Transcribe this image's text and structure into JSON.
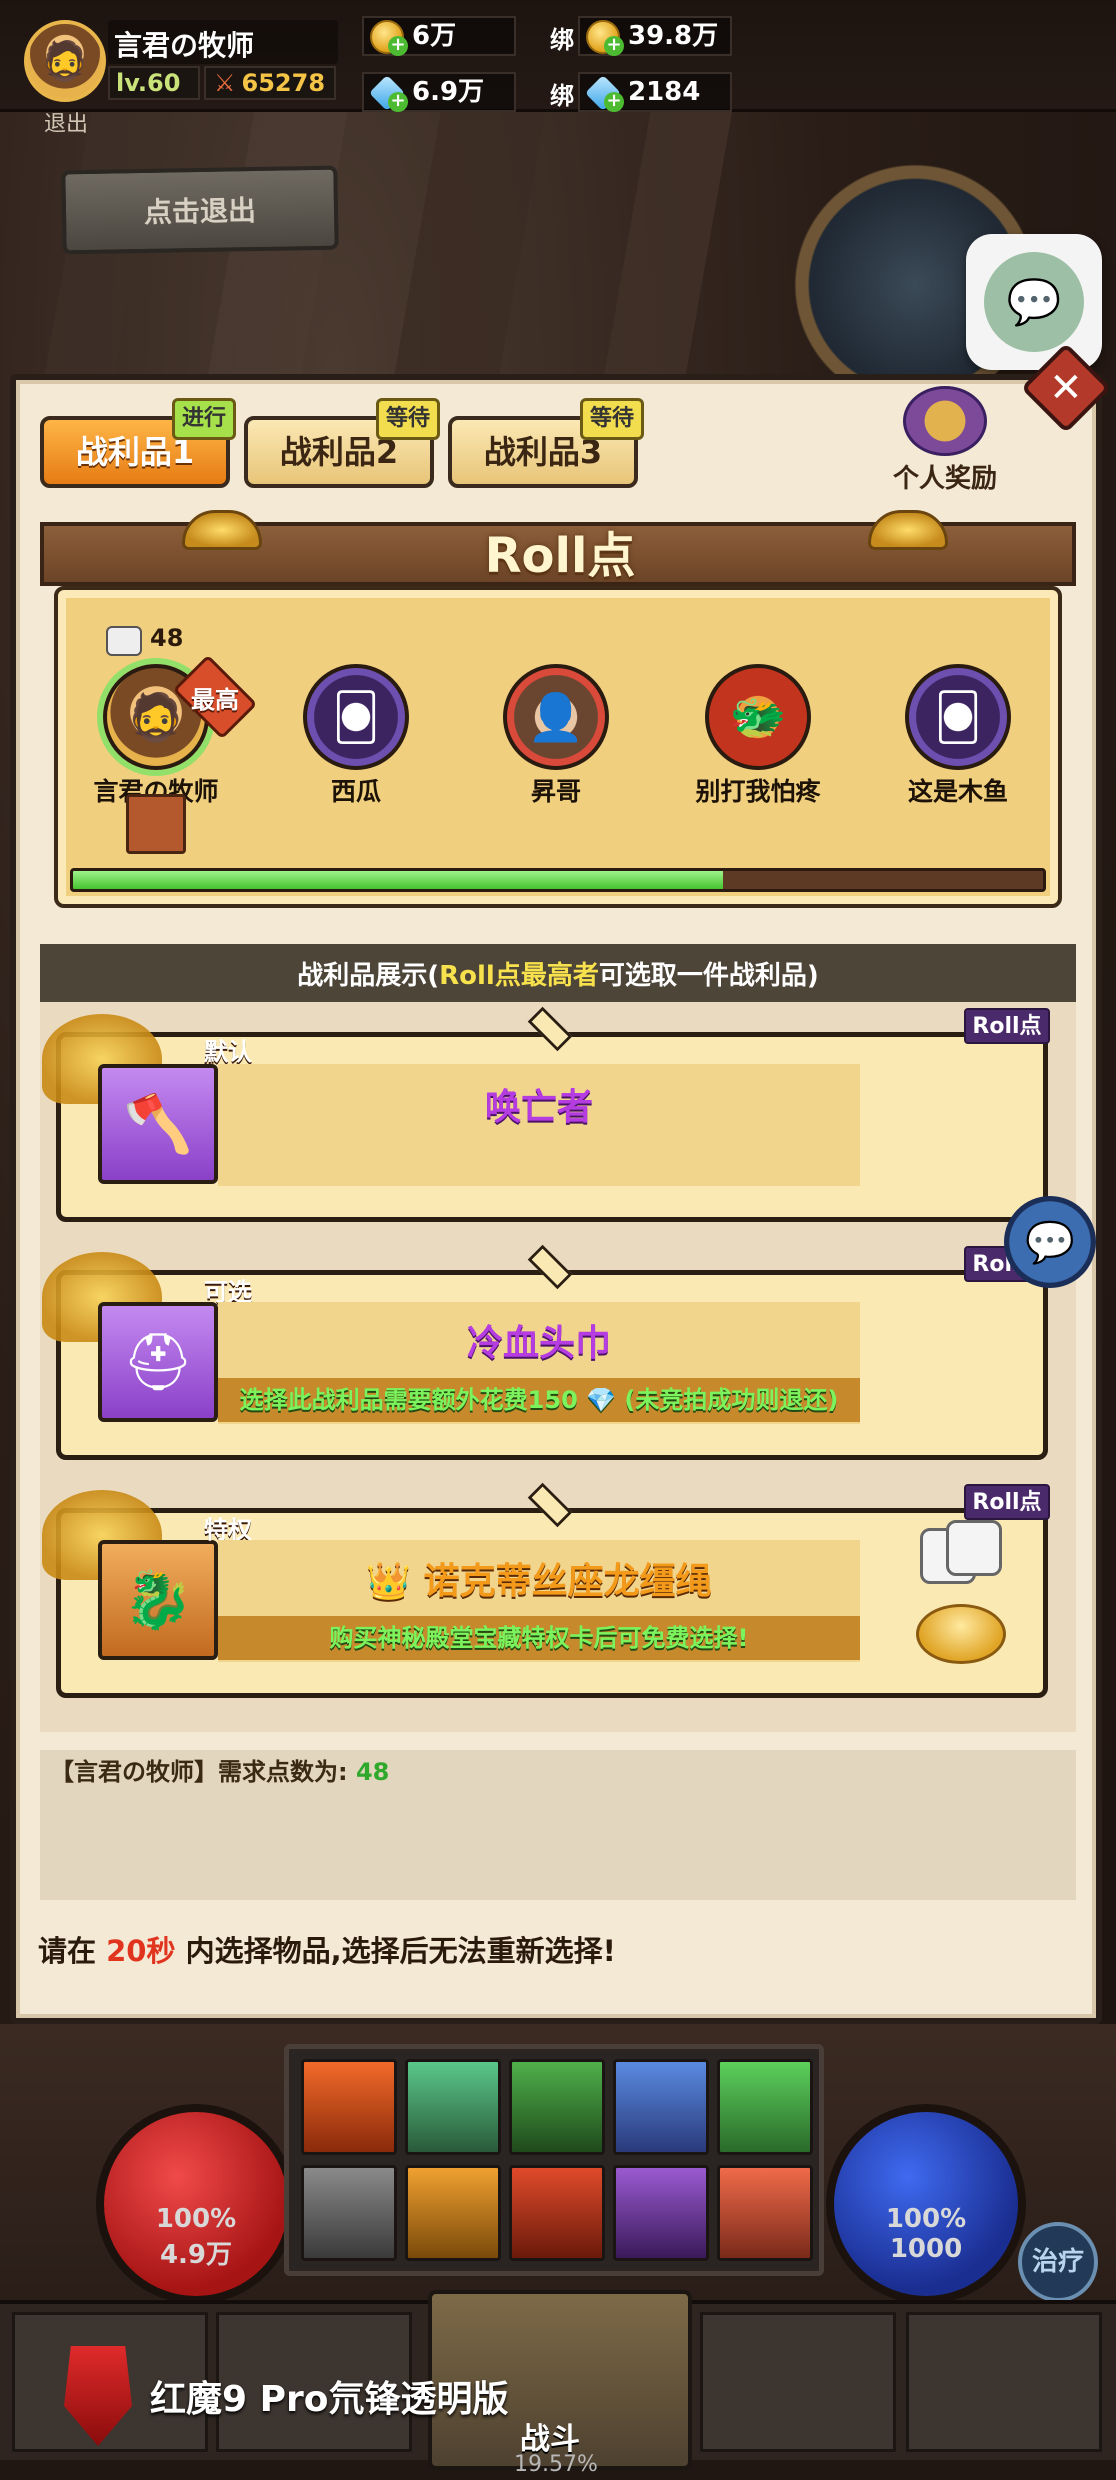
{
  "topbar": {
    "player_name": "言君の牧师",
    "level": "lv.60",
    "power": "65278",
    "gold": "6万",
    "gems": "6.9万",
    "bound_label": "绑",
    "bound_gold": "39.8万",
    "bound_gems": "2184"
  },
  "scene": {
    "exit_button": "点击退出",
    "retreat_label": "退出"
  },
  "tabs": [
    {
      "label": "战利品1",
      "badge": "进行",
      "active": true
    },
    {
      "label": "战利品2",
      "badge": "等待",
      "active": false
    },
    {
      "label": "战利品3",
      "badge": "等待",
      "active": false
    }
  ],
  "personal_reward": {
    "label": "个人奖励"
  },
  "roll": {
    "title": "Roll点",
    "dice_count": "48",
    "top_badge": "最高",
    "progress_fraction": 0.67,
    "players": [
      {
        "name": "言君の牧师"
      },
      {
        "name": "西瓜"
      },
      {
        "name": "昇哥"
      },
      {
        "name": "别打我怕疼"
      },
      {
        "name": "这是木鱼"
      }
    ]
  },
  "info_strip": {
    "prefix": "战利品展示(",
    "highlight": "Roll点最高者",
    "suffix": "可选取一件战利品)"
  },
  "loot": [
    {
      "tag": "默认",
      "name": "唤亡者",
      "note": "",
      "roll_label": "Roll点"
    },
    {
      "tag": "可选",
      "name": "冷血头巾",
      "note": "选择此战利品需要额外花费150 💎 (未竞拍成功则退还)",
      "roll_label": "Roll点"
    },
    {
      "tag": "特权",
      "name": "诺克蒂丝座龙缰绳",
      "note": "购买神秘殿堂宝藏特权卡后可免费选择!",
      "roll_label": "Roll点"
    }
  ],
  "need": {
    "prefix": "【言君の牧师】需求点数为:",
    "value": "48"
  },
  "timer": {
    "prefix": "请在 ",
    "seconds": "20秒",
    "suffix": " 内选择物品,选择后无法重新选择!"
  },
  "hud": {
    "hp_pct": "100%",
    "hp_amt": "4.9万",
    "mp_pct": "100%",
    "mp_amt": "1000",
    "heal": "治疗",
    "battle": "战斗",
    "bottom_pct": "19.57%"
  },
  "brand": {
    "text": "红魔9 Pro氘锋透明版"
  },
  "colors": {
    "accent_orange": "#e57c14",
    "highlight_yellow": "#f7e14c",
    "purple_name": "#b43ce0",
    "orange_name": "#f39a1b",
    "note_green": "#7cf35c",
    "timer_red": "#e0341e"
  }
}
